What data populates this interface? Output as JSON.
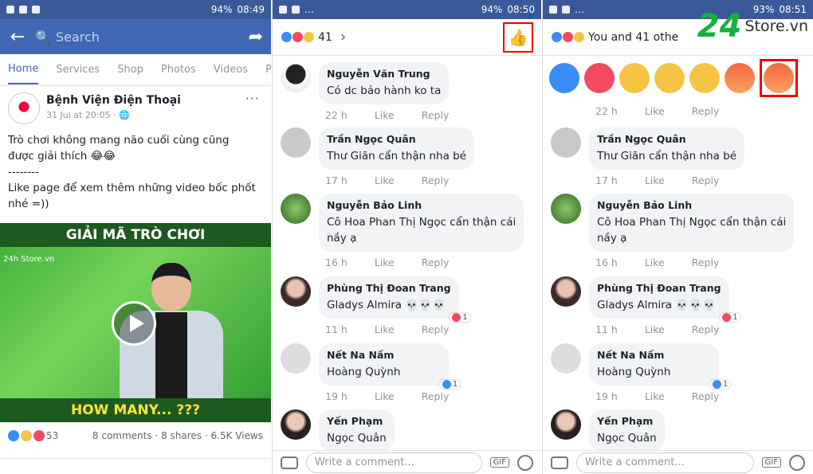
{
  "panel1": {
    "status_time": "08:49",
    "status_battery": "94%",
    "search_placeholder": "Search",
    "tabs": [
      "Home",
      "Services",
      "Shop",
      "Photos",
      "Videos",
      "Po"
    ],
    "author": "Bệnh Viện Điện Thoại",
    "date": "31 Jul at 20:05 · ",
    "post_lines": [
      "Trò chơi không mang não cuối cùng cũng",
      "được giải thích 😂😂",
      "--------",
      "Like page để xem thêm những video bốc phốt",
      "nhé =))"
    ],
    "video_title": "GIẢI MÃ TRÒ CHƠI",
    "video_caption": "HOW MANY... ???",
    "video_logo": "24h Store.vn",
    "reactions_count": "53",
    "comments": "8 comments",
    "shares": "8 shares",
    "views": "6.5K Views"
  },
  "panel2": {
    "status_time": "08:50",
    "status_battery": "94%",
    "reaction_count": "41"
  },
  "panel3": {
    "status_time": "08:51",
    "status_battery": "93%",
    "reaction_text": "You and 41 othe"
  },
  "watermark": {
    "num": "24",
    "site": "Store.vn"
  },
  "comments": [
    {
      "name": "Nguyễn Văn Trung",
      "text": "Có dc bảo hành ko ta",
      "time": "22 h",
      "like": "Like",
      "reply": "Reply"
    },
    {
      "name": "Trần Ngọc Quân",
      "text": "Thư Giãn cẩn thận nha bé",
      "time": "17 h",
      "like": "Like",
      "reply": "Reply"
    },
    {
      "name": "Nguyễn Bảo Linh",
      "text": "Cô Hoa Phan Thị Ngọc cẩn thận cái",
      "text2": "nầy ạ",
      "time": "16 h",
      "like": "Like",
      "reply": "Reply"
    },
    {
      "name": "Phùng Thị Đoan Trang",
      "text": "Gladys Almira 💀💀💀",
      "time": "11 h",
      "like": "Like",
      "reply": "Reply",
      "badge": "1"
    },
    {
      "name": "Nết Na Nấm",
      "text": "Hoàng Quỳnh",
      "time": "19 h",
      "like": "Like",
      "reply": "Reply",
      "badge": "1"
    },
    {
      "name": "Yến Phạm",
      "text": "Ngọc Quân"
    }
  ],
  "composer_placeholder": "Write a comment...",
  "gif_label": "GIF",
  "colors": {
    "fb_blue": "#4267b2",
    "like_blue": "#3b8cf6",
    "love_red": "#f24a63",
    "highlight": "#e00000"
  }
}
